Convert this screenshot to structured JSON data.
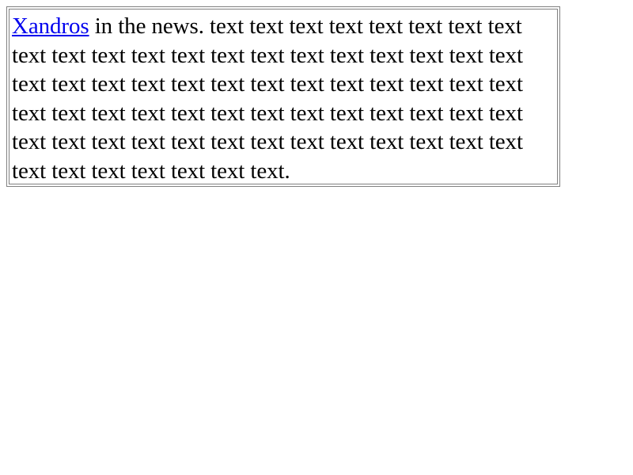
{
  "article": {
    "link_text": "Xandros",
    "body_text": " in the news. text text text text text text text text text text text text text text text text text text text text text text text text text text text text text text text text text text text text text text text text text text text text text text text text text text text text text text text text text text text text text text text text text text text."
  },
  "colors": {
    "link": "#0000ee",
    "text": "#000000",
    "border": "#808080",
    "background": "#ffffff"
  }
}
